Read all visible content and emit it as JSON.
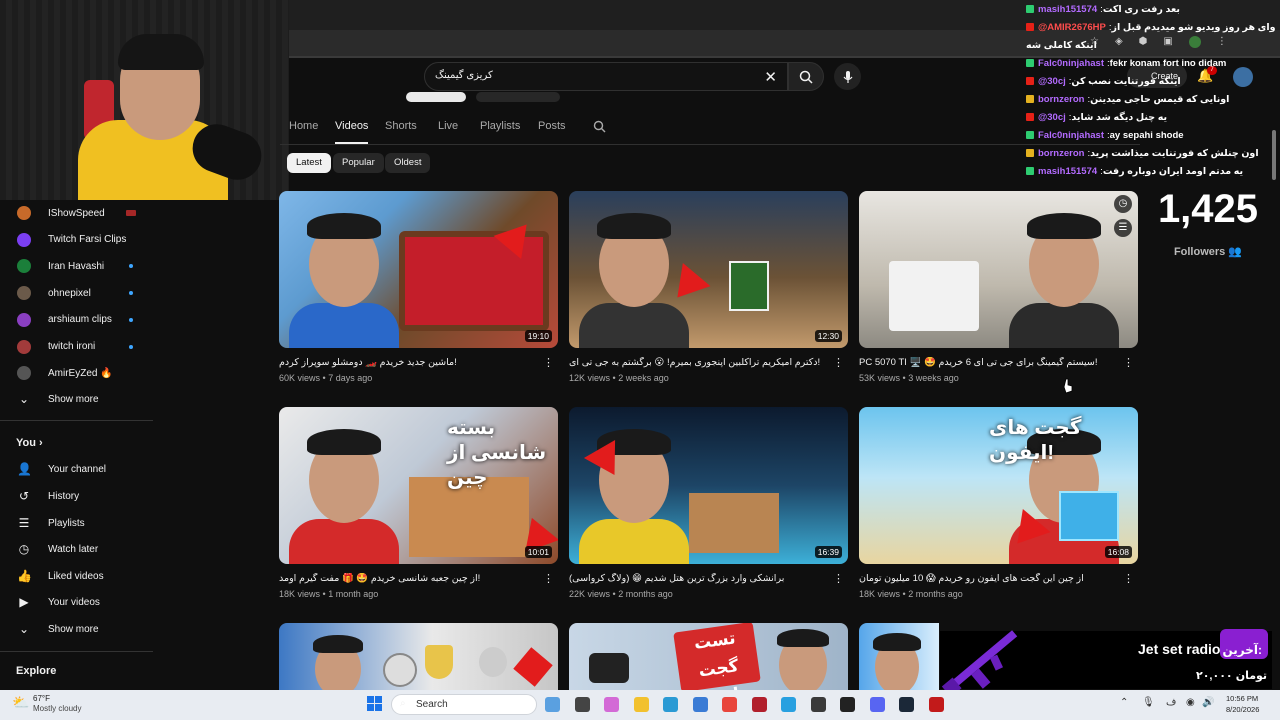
{
  "search": {
    "query": "کریزی گیمینگ"
  },
  "channel_tabs": [
    "Home",
    "Videos",
    "Shorts",
    "Live",
    "Playlists",
    "Posts"
  ],
  "chips": [
    "Latest",
    "Popular",
    "Oldest"
  ],
  "header": {
    "create_label": "Create",
    "notif_count": "7"
  },
  "sidebar": {
    "subs": [
      {
        "label": "IShowSpeed",
        "color": "#c76a2a",
        "state": "live"
      },
      {
        "label": "Twitch Farsi Clips",
        "color": "#7b3ff2",
        "state": ""
      },
      {
        "label": "Iran Havashi",
        "color": "#1b7f3a",
        "state": "dot"
      },
      {
        "label": "ohnepixel",
        "color": "#6b5a4a",
        "state": "dot"
      },
      {
        "label": "arshiaum clips",
        "color": "#8a3fc1",
        "state": "dot"
      },
      {
        "label": "twitch ironi",
        "color": "#a23b3b",
        "state": "dot"
      },
      {
        "label": "AmirEyZed 🔥",
        "color": "#555555",
        "state": ""
      }
    ],
    "show_more_1": "Show more",
    "you_header": "You",
    "you_items": [
      "Your channel",
      "History",
      "Playlists",
      "Watch later",
      "Liked videos",
      "Your videos"
    ],
    "show_more_2": "Show more",
    "explore_header": "Explore"
  },
  "videos": [
    {
      "title": "ماشین جدید خریدم 🏎️ دومشلو سوپراز کردم!",
      "views": "60K views",
      "age": "7 days ago",
      "duration": "19:10"
    },
    {
      "title": "دکترم امیکریم تراکلبین اپنجوری بمیرم! 😮 برگشتم به جی تی ای!",
      "views": "12K views",
      "age": "2 weeks ago",
      "duration": "12:30"
    },
    {
      "title": "PC 5070 TI 🖥️ 🤩 سیستم گیمینگ برای جی تی ای 6 خریدم!",
      "views": "53K views",
      "age": "3 weeks ago",
      "duration": ""
    },
    {
      "title": "از چین جعبه شانسی خریدم 🤩 🎁 مفت گیرم اومد!",
      "views": "18K views",
      "age": "1 month ago",
      "duration": "10:01"
    },
    {
      "title": "(ولاگ کرواسی) 😁 برانشکی وارد بزرگ ترین هتل شدیم",
      "views": "22K views",
      "age": "2 months ago",
      "duration": "16:39"
    },
    {
      "title": "از چین این گجت های ایفون رو خریدم 😱 10 میلیون تومان",
      "views": "18K views",
      "age": "2 months ago",
      "duration": "16:08"
    }
  ],
  "thumb_texts": {
    "t4": "بسته شانسی از چین",
    "t6": "گجت های ایفون!",
    "t8": "تست گجت ماشین"
  },
  "chat": [
    {
      "user": "masih151574",
      "msg": "بعد رفت ری اکت",
      "user_color": "#b36bff",
      "badge": "#2ecc71"
    },
    {
      "user": "@AMIR2676HP",
      "msg": "حاجبی وای هر روز ویدیو شو میدیدم قبل از",
      "user_color": "#ff4d4d",
      "badge": "#e62117"
    },
    {
      "user": "",
      "msg": "اینکه کاملی شه",
      "user_color": "#ffffff",
      "badge": ""
    },
    {
      "user": "Falc0ninjahast",
      "msg": "fekr konam fort ino didam",
      "user_color": "#b36bff",
      "badge": "#2ecc71"
    },
    {
      "user": "@30cj",
      "msg": "اینکه فورتنایت نصب کن",
      "user_color": "#b36bff",
      "badge": "#e62117"
    },
    {
      "user": "bornzeron",
      "msg": "اونایی که قیمس حاجی میدینن",
      "user_color": "#b36bff",
      "badge": "#e5b220"
    },
    {
      "user": "@30cj",
      "msg": "یه چنل دیگه شد شاید",
      "user_color": "#b36bff",
      "badge": "#e62117"
    },
    {
      "user": "Falc0ninjahast",
      "msg": "ay sepahi shode",
      "user_color": "#b36bff",
      "badge": "#2ecc71"
    },
    {
      "user": "bornzeron",
      "msg": "اون چنلش که فورتنایت میذاشت پرید",
      "user_color": "#b36bff",
      "badge": "#e5b220"
    },
    {
      "user": "masih151574",
      "msg": "یه مدتم اومد ایران دوباره رفت",
      "user_color": "#b36bff",
      "badge": "#2ecc71"
    }
  ],
  "followers": {
    "count": "1,425",
    "label": "Followers"
  },
  "ad": {
    "tag": "آخرین:",
    "title": "Jet set radio",
    "price": "۲۰,۰۰۰ تومان"
  },
  "taskbar": {
    "weather_temp": "67°F",
    "weather_desc": "Mostly cloudy",
    "search_label": "Search",
    "time": "10:56 PM",
    "date": "8/20/2026"
  }
}
